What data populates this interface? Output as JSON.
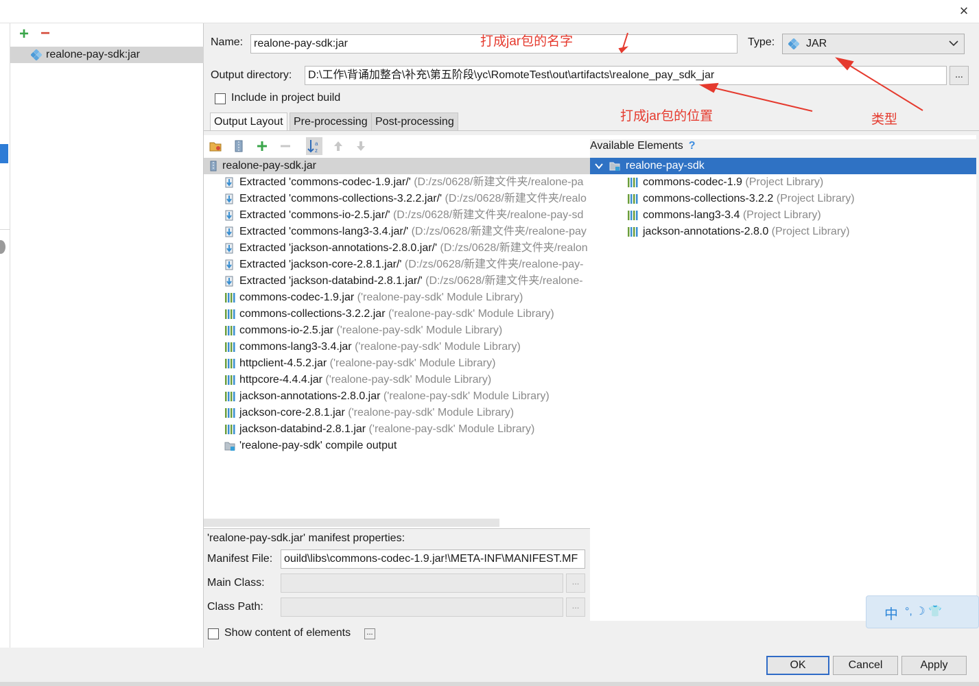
{
  "dialog": {
    "close_label": "×"
  },
  "artifacts": {
    "add_label": "+",
    "remove_label": "−",
    "selected": "realone-pay-sdk:jar"
  },
  "form": {
    "name_label": "Name:",
    "name_value": "realone-pay-sdk:jar",
    "type_label": "Type:",
    "type_value": "JAR",
    "output_dir_label": "Output directory:",
    "output_dir_value": "D:\\工作\\背诵加整合\\补充\\第五阶段\\yc\\RomoteTest\\out\\artifacts\\realone_pay_sdk_jar",
    "browse_label": "...",
    "include_label": "Include in project build"
  },
  "tabs": [
    "Output Layout",
    "Pre-processing",
    "Post-processing"
  ],
  "layout_tree": {
    "root": "realone-pay-sdk.jar",
    "extracted": [
      {
        "name": "Extracted 'commons-codec-1.9.jar/'",
        "path": "(D:/zs/0628/新建文件夹/realone-pa"
      },
      {
        "name": "Extracted 'commons-collections-3.2.2.jar/'",
        "path": "(D:/zs/0628/新建文件夹/realo"
      },
      {
        "name": "Extracted 'commons-io-2.5.jar/'",
        "path": "(D:/zs/0628/新建文件夹/realone-pay-sd"
      },
      {
        "name": "Extracted 'commons-lang3-3.4.jar/'",
        "path": "(D:/zs/0628/新建文件夹/realone-pay"
      },
      {
        "name": "Extracted 'jackson-annotations-2.8.0.jar/'",
        "path": "(D:/zs/0628/新建文件夹/realon"
      },
      {
        "name": "Extracted 'jackson-core-2.8.1.jar/'",
        "path": "(D:/zs/0628/新建文件夹/realone-pay-"
      },
      {
        "name": "Extracted 'jackson-databind-2.8.1.jar/'",
        "path": "(D:/zs/0628/新建文件夹/realone-"
      }
    ],
    "libraries": [
      {
        "name": "commons-codec-1.9.jar",
        "note": "('realone-pay-sdk' Module Library)"
      },
      {
        "name": "commons-collections-3.2.2.jar",
        "note": "('realone-pay-sdk' Module Library)"
      },
      {
        "name": "commons-io-2.5.jar",
        "note": "('realone-pay-sdk' Module Library)"
      },
      {
        "name": "commons-lang3-3.4.jar",
        "note": "('realone-pay-sdk' Module Library)"
      },
      {
        "name": "httpclient-4.5.2.jar",
        "note": "('realone-pay-sdk' Module Library)"
      },
      {
        "name": "httpcore-4.4.4.jar",
        "note": "('realone-pay-sdk' Module Library)"
      },
      {
        "name": "jackson-annotations-2.8.0.jar",
        "note": "('realone-pay-sdk' Module Library)"
      },
      {
        "name": "jackson-core-2.8.1.jar",
        "note": "('realone-pay-sdk' Module Library)"
      },
      {
        "name": "jackson-databind-2.8.1.jar",
        "note": "('realone-pay-sdk' Module Library)"
      }
    ],
    "compile_output": "'realone-pay-sdk' compile output"
  },
  "available": {
    "title": "Available Elements",
    "help": "?",
    "module": "realone-pay-sdk",
    "items": [
      {
        "name": "commons-codec-1.9",
        "note": "(Project Library)"
      },
      {
        "name": "commons-collections-3.2.2",
        "note": "(Project Library)"
      },
      {
        "name": "commons-lang3-3.4",
        "note": "(Project Library)"
      },
      {
        "name": "jackson-annotations-2.8.0",
        "note": "(Project Library)"
      }
    ]
  },
  "manifest": {
    "title": "'realone-pay-sdk.jar' manifest properties:",
    "file_label": "Manifest File:",
    "file_value": "ouild\\libs\\commons-codec-1.9.jar!\\META-INF\\MANIFEST.MF",
    "main_class_label": "Main Class:",
    "class_path_label": "Class Path:",
    "ellipsis": "...",
    "show_content_label": "Show content of elements"
  },
  "buttons": {
    "ok": "OK",
    "cancel": "Cancel",
    "apply": "Apply"
  },
  "annotations": {
    "name_note": "打成jar包的名字",
    "location_note": "打成jar包的位置",
    "type_note": "类型"
  },
  "ime": {
    "lang": "中",
    "symbols": "°, ☽ 👕"
  },
  "colors": {
    "annotation": "#e53a2e",
    "selection": "#2f72c4",
    "accent": "#2e7cd6"
  }
}
